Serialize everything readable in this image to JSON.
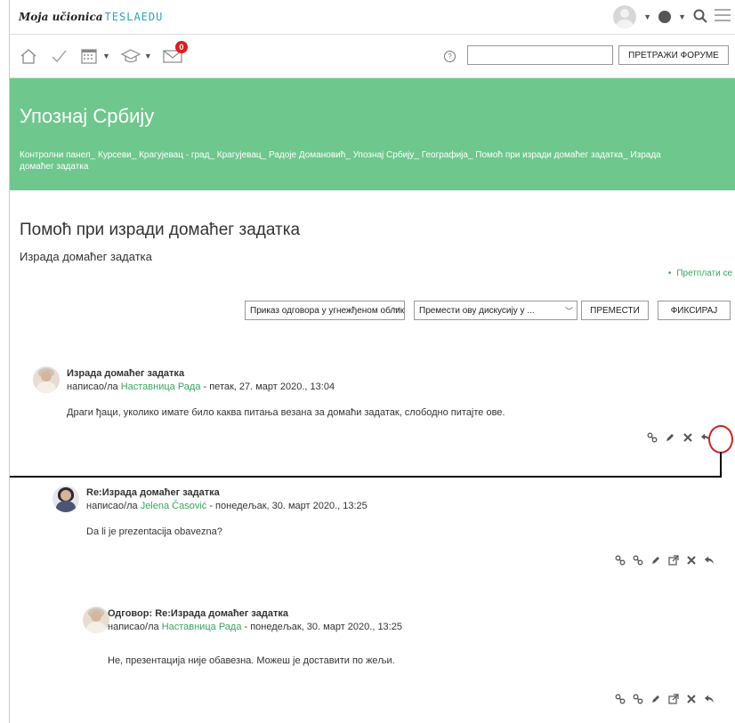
{
  "brand": {
    "name": "Moja učionica",
    "tesla": "TESLAEDU"
  },
  "toolbar": {
    "notifications_count": "0",
    "search_button": "ПРЕТРАЖИ ФОРУМЕ",
    "search_value": ""
  },
  "banner": {
    "title": "Упознај Србију",
    "breadcrumbs": "Контролни панел_ Курсеви_ Крагујевац - град_ Крагујевац_ Радоје Домановић_ Упознај Србију_ Географија_ Помоћ при изради домаћег задатка_ Израда домаћег задатка"
  },
  "page": {
    "title": "Помоћ при изради домаћег задатка",
    "subtitle": "Израда домаћег задатка",
    "subscribe": "Претплати се"
  },
  "controls": {
    "display_select": "Приказ одговора у угнежђеном облику",
    "move_select": "Премести ову дискусију у ...",
    "move_button": "ПРЕМЕСТИ",
    "pin_button": "ФИКСИРАЈ"
  },
  "posts": [
    {
      "title": "Израда домаћег задатка",
      "by_prefix": "написао/ла ",
      "author": "Наставница Рада",
      "date": " - петак, 27. март 2020., 13:04",
      "body": "Драги ђаци, уколико имате било каква питања везана за домаћи задатак, слободно питајте ове."
    },
    {
      "title": "Re:Израда домаћег задатка",
      "by_prefix": "написао/ла ",
      "author": "Jelena Časović",
      "date": " - понедељак, 30. март 2020., 13:25",
      "body": "Da li je prezentacija obavezna?"
    },
    {
      "title": "Одговор: Re:Израда домаћег задатка",
      "by_prefix": "написао/ла ",
      "author": "Наставница Рада",
      "date": " - понедељак, 30. март 2020., 13:25",
      "body": "Не, презентација није обавезна. Можеш је доставити по жељи."
    }
  ],
  "icons": {
    "accent": "#6ec78c",
    "link": "#3ba55c",
    "badge": "#e21b1b",
    "highlight": "#d42222"
  }
}
